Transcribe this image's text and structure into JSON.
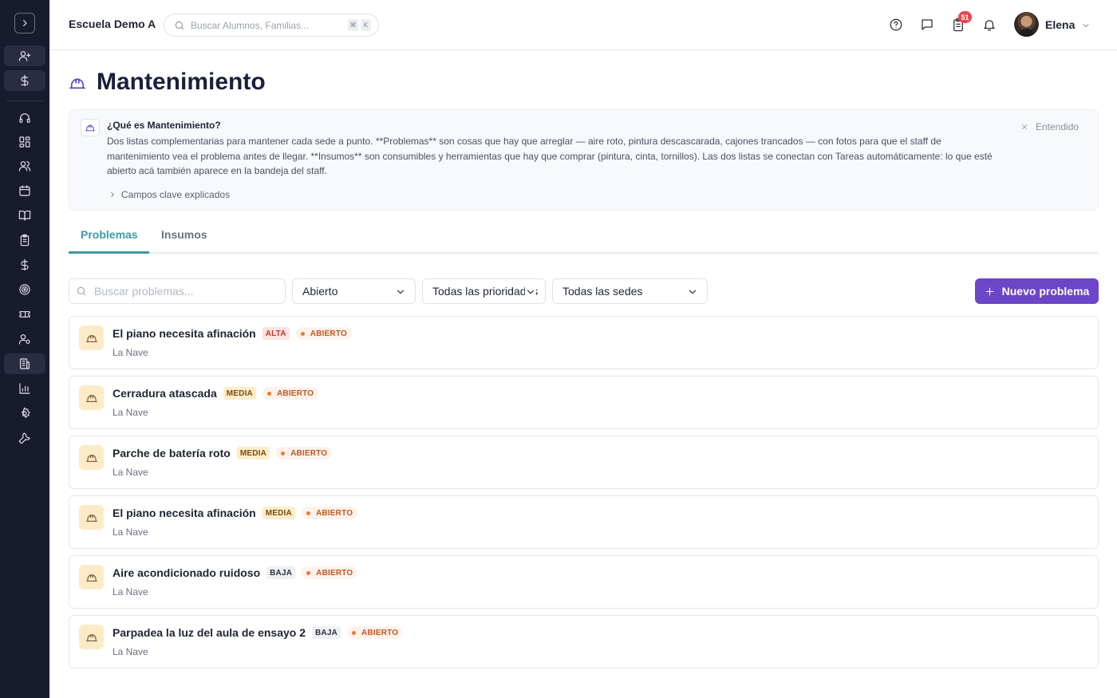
{
  "header": {
    "school_name": "Escuela Demo A",
    "search_placeholder": "Buscar Alumnos, Familias...",
    "shortcut_keys": [
      "⌘",
      "K"
    ],
    "notification_count": "51",
    "user_name": "Elena"
  },
  "sidebar": {
    "items": [
      {
        "icon": "user-plus-icon"
      },
      {
        "icon": "dollar-icon"
      },
      {
        "icon": "headset-icon"
      },
      {
        "icon": "dashboard-icon"
      },
      {
        "icon": "users-icon"
      },
      {
        "icon": "calendar-icon"
      },
      {
        "icon": "book-icon"
      },
      {
        "icon": "clipboard-icon"
      },
      {
        "icon": "dollar-icon"
      },
      {
        "icon": "target-icon"
      },
      {
        "icon": "ticket-icon"
      },
      {
        "icon": "user-cog-icon"
      },
      {
        "icon": "building-icon",
        "active": true
      },
      {
        "icon": "bar-chart-icon"
      },
      {
        "icon": "settings-icon"
      },
      {
        "icon": "wrench-icon"
      }
    ]
  },
  "page": {
    "title": "Mantenimiento",
    "icon": "hard-hat-icon"
  },
  "info": {
    "title": "¿Qué es Mantenimiento?",
    "body": "Dos listas complementarias para mantener cada sede a punto. **Problemas** son cosas que hay que arreglar — aire roto, pintura descascarada, cajones trancados — con fotos para que el staff de mantenimiento vea el problema antes de llegar. **Insumos** son consumibles y herramientas que hay que comprar (pintura, cinta, tornillos). Las dos listas se conectan con Tareas automáticamente: lo que esté abierto acá también aparece en la bandeja del staff.",
    "link": "Campos clave explicados",
    "dismiss": "Entendido"
  },
  "tabs": [
    {
      "label": "Problemas",
      "active": true
    },
    {
      "label": "Insumos",
      "active": false
    }
  ],
  "filters": {
    "search_placeholder": "Buscar problemas...",
    "status": "Abierto",
    "priority": "Todas las prioridades",
    "site": "Todas las sedes",
    "new_button": "Nuevo problema"
  },
  "problems": [
    {
      "title": "El piano necesita afinación",
      "priority": "ALTA",
      "status": "ABIERTO",
      "site": "La Nave"
    },
    {
      "title": "Cerradura atascada",
      "priority": "MEDIA",
      "status": "ABIERTO",
      "site": "La Nave"
    },
    {
      "title": "Parche de batería roto",
      "priority": "MEDIA",
      "status": "ABIERTO",
      "site": "La Nave"
    },
    {
      "title": "El piano necesita afinación",
      "priority": "MEDIA",
      "status": "ABIERTO",
      "site": "La Nave"
    },
    {
      "title": "Aire acondicionado ruidoso",
      "priority": "BAJA",
      "status": "ABIERTO",
      "site": "La Nave"
    },
    {
      "title": "Parpadea la luz del aula de ensayo 2",
      "priority": "BAJA",
      "status": "ABIERTO",
      "site": "La Nave"
    }
  ],
  "colors": {
    "accent": "#6b46c8",
    "tab_active": "#3c9aa5",
    "sidebar_bg": "#181a2e"
  }
}
